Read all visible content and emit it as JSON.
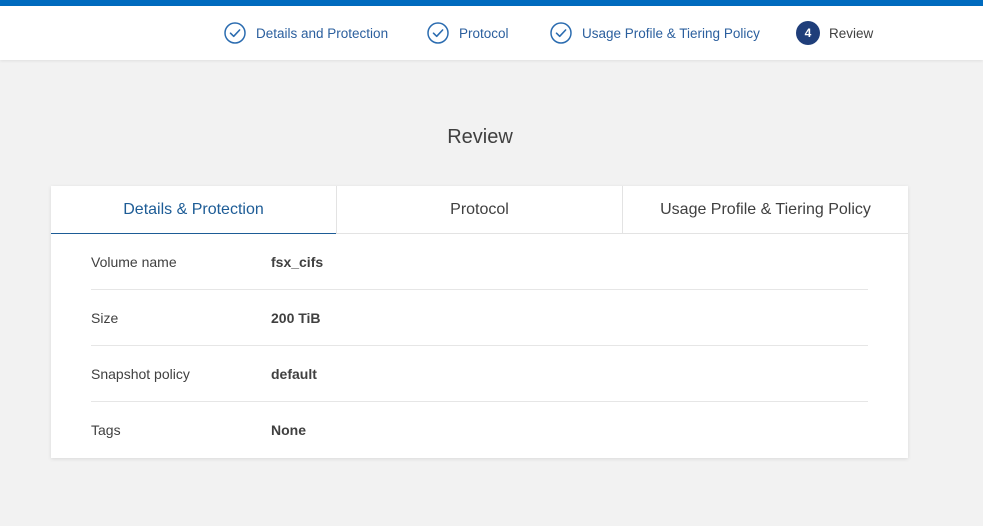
{
  "stepper": {
    "steps": [
      {
        "label": "Details and Protection",
        "state": "complete",
        "icon": "check-circle-icon"
      },
      {
        "label": "Protocol",
        "state": "complete",
        "icon": "check-circle-icon"
      },
      {
        "label": "Usage Profile & Tiering Policy",
        "state": "complete",
        "icon": "check-circle-icon"
      },
      {
        "label": "Review",
        "state": "current",
        "number": "4"
      }
    ]
  },
  "page": {
    "title": "Review"
  },
  "review": {
    "tabs": [
      {
        "label": "Details & Protection",
        "active": true
      },
      {
        "label": "Protocol",
        "active": false
      },
      {
        "label": "Usage Profile & Tiering Policy",
        "active": false
      }
    ],
    "rows": [
      {
        "label": "Volume name",
        "value": "fsx_cifs"
      },
      {
        "label": "Size",
        "value": "200 TiB"
      },
      {
        "label": "Snapshot policy",
        "value": "default"
      },
      {
        "label": "Tags",
        "value": "None"
      }
    ]
  },
  "colors": {
    "accent": "#006bbf",
    "step_text": "#2b5f9e",
    "current_badge": "#1f3e7a",
    "active_tab": "#1d5c96",
    "background": "#f2f2f2"
  }
}
